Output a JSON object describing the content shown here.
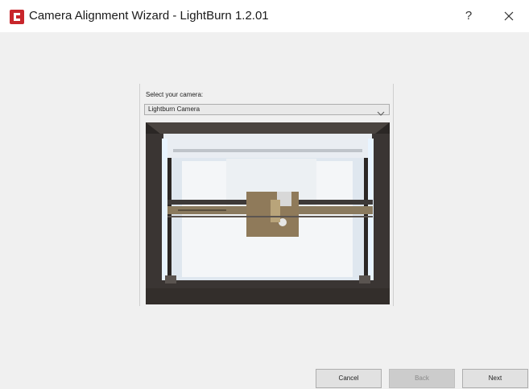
{
  "window": {
    "title": "Camera Alignment Wizard - LightBurn 1.2.01",
    "app_icon": "lightburn-logo",
    "help_label": "?",
    "close_label": "×"
  },
  "camera": {
    "select_label": "Select your camera:",
    "selected": "Lightburn Camera",
    "preview_image": "camera-preview"
  },
  "buttons": {
    "cancel": "Cancel",
    "back": "Back",
    "next": "Next",
    "back_enabled": false
  },
  "colors": {
    "accent": "#c8262b",
    "window_bg": "#f0f0f0"
  }
}
